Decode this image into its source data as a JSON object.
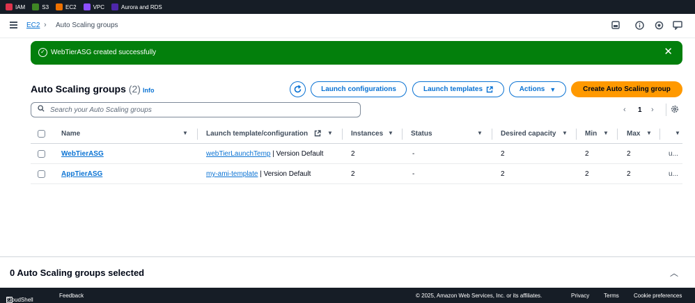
{
  "favorites": [
    {
      "label": "IAM",
      "color": "#dd344c"
    },
    {
      "label": "S3",
      "color": "#3f8624"
    },
    {
      "label": "EC2",
      "color": "#ed7100"
    },
    {
      "label": "VPC",
      "color": "#8c4fff"
    },
    {
      "label": "Aurora and RDS",
      "color": "#4d27aa"
    }
  ],
  "breadcrumb": {
    "root": "EC2",
    "current": "Auto Scaling groups"
  },
  "flash": {
    "message": "WebTierASG created successfully"
  },
  "header": {
    "title": "Auto Scaling groups",
    "count": "(2)",
    "info": "Info",
    "buttons": {
      "launch_configurations": "Launch configurations",
      "launch_templates": "Launch templates",
      "actions": "Actions",
      "create": "Create Auto Scaling group"
    }
  },
  "search": {
    "placeholder": "Search your Auto Scaling groups"
  },
  "pagination": {
    "page": "1"
  },
  "table": {
    "columns": {
      "name": "Name",
      "launch": "Launch template/configuration",
      "instances": "Instances",
      "status": "Status",
      "desired": "Desired capacity",
      "min": "Min",
      "max": "Max"
    },
    "rows": [
      {
        "name": "WebTierASG",
        "template_link": "webTierLaunchTemp",
        "template_version": " | Version Default",
        "instances": "2",
        "status": "-",
        "desired": "2",
        "min": "2",
        "max": "2",
        "extra": "u..."
      },
      {
        "name": "AppTierASG",
        "template_link": "my-ami-template",
        "template_version": " | Version Default",
        "instances": "2",
        "status": "-",
        "desired": "2",
        "min": "2",
        "max": "2",
        "extra": "u..."
      }
    ]
  },
  "split_panel": {
    "title": "0 Auto Scaling groups selected"
  },
  "footer": {
    "cloudshell": "CloudShell",
    "feedback": "Feedback",
    "copyright": "© 2025, Amazon Web Services, Inc. or its affiliates.",
    "privacy": "Privacy",
    "terms": "Terms",
    "cookies": "Cookie preferences"
  }
}
